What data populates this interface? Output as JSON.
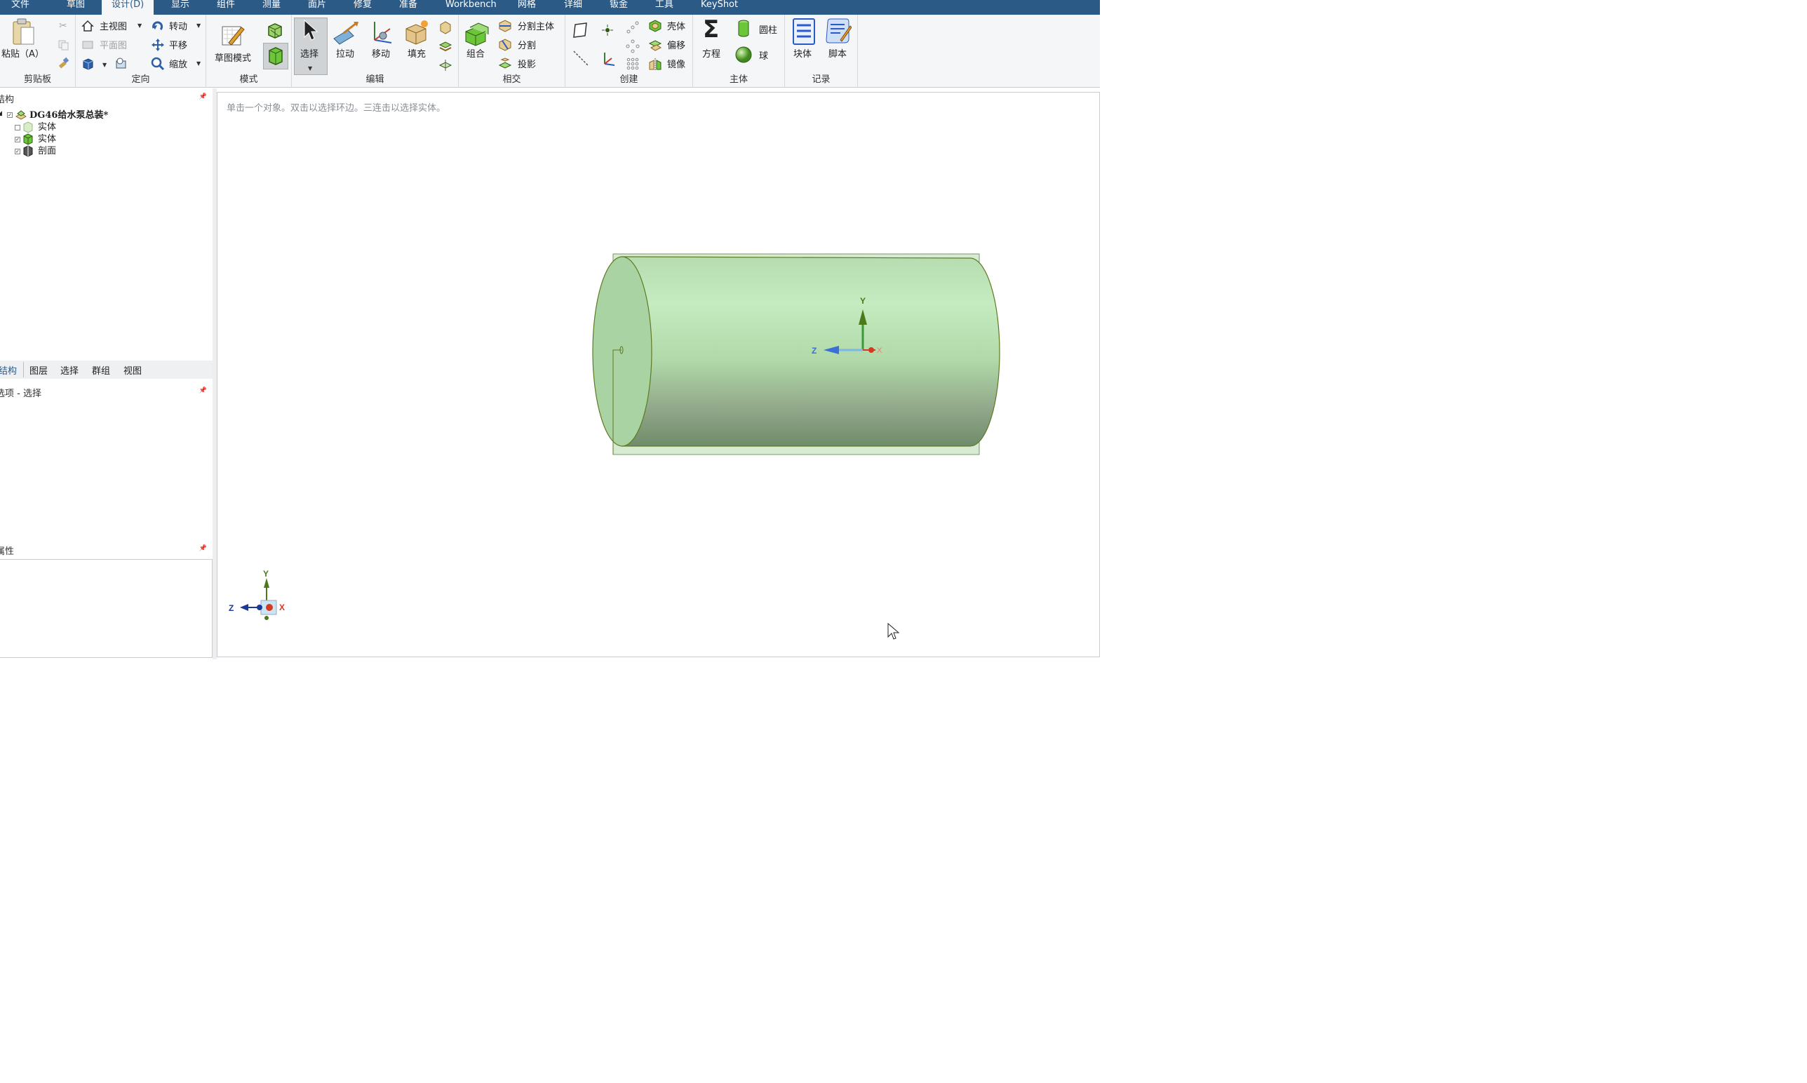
{
  "menu": {
    "items": [
      "文件",
      "草图",
      "设计(D)",
      "显示",
      "组件",
      "测量",
      "面片",
      "修复",
      "准备",
      "Workbench",
      "网格",
      "详细",
      "钣金",
      "工具",
      "KeyShot"
    ],
    "active_index": 2
  },
  "ribbon": {
    "clipboard": {
      "paste_label": "粘贴（A）",
      "group_label": "剪贴板"
    },
    "orient": {
      "home_view": "主视图",
      "plan_view": "平面图",
      "rotate": "转动",
      "pan": "平移",
      "zoom": "缩放",
      "group_label": "定向"
    },
    "mode": {
      "sketch_mode": "草图模式",
      "group_label": "模式"
    },
    "edit": {
      "select": "选择",
      "pull": "拉动",
      "move": "移动",
      "fill": "填充",
      "group_label": "编辑"
    },
    "intersect": {
      "combine": "组合",
      "split_body": "分割主体",
      "split": "分割",
      "project": "投影",
      "group_label": "相交"
    },
    "create": {
      "shell": "壳体",
      "offset": "偏移",
      "mirror": "镜像",
      "group_label": "创建"
    },
    "body": {
      "equation": "方程",
      "cylinder": "圆柱",
      "sphere": "球",
      "group_label": "主体"
    },
    "record": {
      "block": "块体",
      "script": "脚本",
      "group_label": "记录"
    }
  },
  "structure": {
    "title": "结构",
    "root": "DG46给水泵总装*",
    "children": [
      {
        "label": "实体",
        "checked": false
      },
      {
        "label": "实体",
        "checked": true
      },
      {
        "label": "剖面",
        "checked": true
      }
    ]
  },
  "tabs": [
    "结构",
    "图层",
    "选择",
    "群组",
    "视图"
  ],
  "options_title": "选项 - 选择",
  "properties_title": "属性",
  "viewport": {
    "hint": "单击一个对象。双击以选择环边。三连击以选择实体。",
    "axis_labels": {
      "x": "X",
      "y": "Y",
      "z": "Z"
    }
  },
  "colors": {
    "menubar": "#2b5a86",
    "cylinder_fill": "#b8e2b4",
    "cylinder_edge": "#5e7a22",
    "axis_y": "#3a9a3a",
    "axis_z": "#3b6fd6",
    "axis_x": "#d63a1e"
  }
}
